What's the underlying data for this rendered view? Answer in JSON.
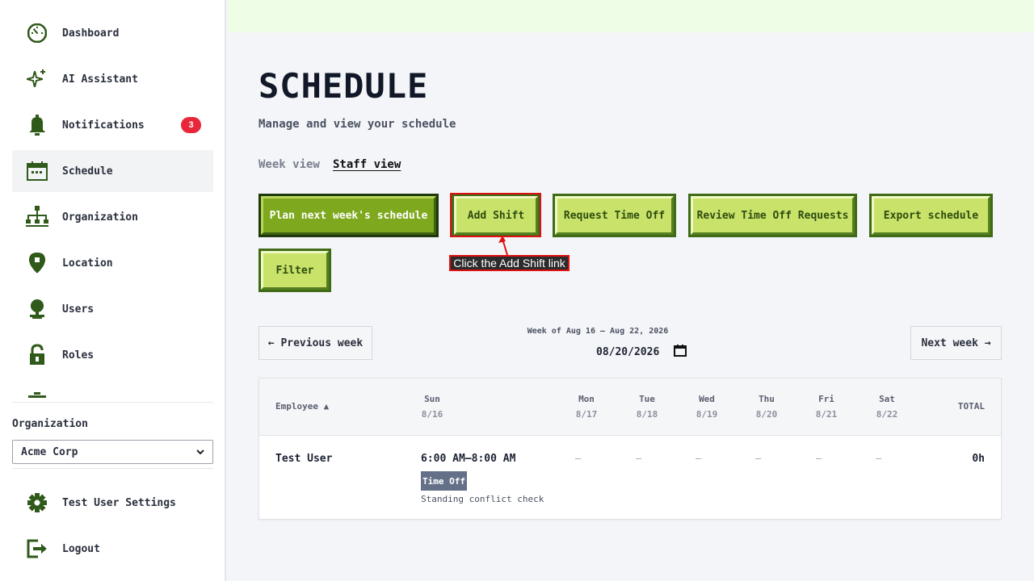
{
  "sidebar": {
    "items": [
      {
        "label": "Dashboard",
        "icon": "dashboard-gauge-icon"
      },
      {
        "label": "AI Assistant",
        "icon": "sparkle-icon"
      },
      {
        "label": "Notifications",
        "icon": "bell-icon",
        "badge": "3"
      },
      {
        "label": "Schedule",
        "icon": "calendar-icon",
        "active": true
      },
      {
        "label": "Organization",
        "icon": "org-chart-icon"
      },
      {
        "label": "Location",
        "icon": "map-pin-icon"
      },
      {
        "label": "Users",
        "icon": "user-icon"
      },
      {
        "label": "Roles",
        "icon": "lock-icon"
      }
    ],
    "organization_label": "Organization",
    "organization_value": "Acme Corp",
    "settings_label": "Test User Settings",
    "logout_label": "Logout"
  },
  "page": {
    "title": "SCHEDULE",
    "subtitle": "Manage and view your schedule",
    "tabs": {
      "week": "Week view",
      "staff": "Staff view"
    }
  },
  "actions": {
    "plan": "Plan next week's schedule",
    "add_shift": "Add Shift",
    "request_time_off": "Request Time Off",
    "review_time_off": "Review Time Off Requests",
    "export": "Export schedule",
    "filter": "Filter"
  },
  "tooltip": "Click the Add Shift link",
  "week_nav": {
    "prev": "← Previous week",
    "next": "Next week →",
    "week_of": "Week of Aug 16 – Aug 22, 2026",
    "date_value": "08/20/2026"
  },
  "table": {
    "employee_header": "Employee ▲",
    "total_header": "TOTAL",
    "days": [
      {
        "day": "Sun",
        "date": "8/16"
      },
      {
        "day": "Mon",
        "date": "8/17"
      },
      {
        "day": "Tue",
        "date": "8/18"
      },
      {
        "day": "Wed",
        "date": "8/19"
      },
      {
        "day": "Thu",
        "date": "8/20"
      },
      {
        "day": "Fri",
        "date": "8/21"
      },
      {
        "day": "Sat",
        "date": "8/22"
      }
    ],
    "rows": [
      {
        "employee": "Test User",
        "sun_shift": "6:00 AM–8:00 AM",
        "sun_tag": "Time Off",
        "sun_note": "Standing conflict check",
        "empty": "–",
        "total": "0h"
      }
    ]
  },
  "colors": {
    "accent_green": "#3f6a16",
    "button_fill": "#c9e26a",
    "badge_red": "#e8283a",
    "highlight_red": "#e01010"
  }
}
